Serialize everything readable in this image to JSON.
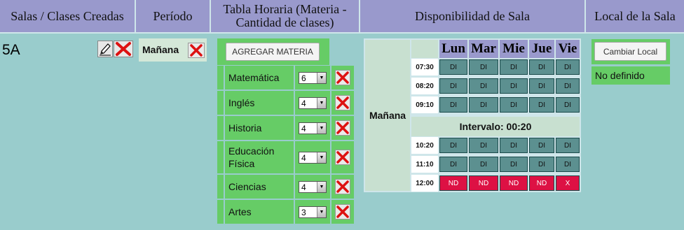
{
  "headers": {
    "salas": "Salas / Clases Creadas",
    "periodo": "Período",
    "tabla": "Tabla Horaria (Materia - Cantidad de clases)",
    "disponibilidad": "Disponibilidad de Sala",
    "local": "Local de la Sala"
  },
  "sala": {
    "name": "5A",
    "edit_icon": "pencil-icon",
    "delete_icon": "red-x-icon"
  },
  "periodo": {
    "label": "Mañana",
    "delete_icon": "red-x-icon"
  },
  "tabla": {
    "add_button": "AGREGAR MATERIA",
    "materias": [
      {
        "name": "Matemática",
        "count": "6"
      },
      {
        "name": "Inglés",
        "count": "4"
      },
      {
        "name": "Historia",
        "count": "4"
      },
      {
        "name": "Educación Física",
        "count": "4"
      },
      {
        "name": "Ciencias",
        "count": "4"
      },
      {
        "name": "Artes",
        "count": "3"
      }
    ]
  },
  "disponibilidad": {
    "periodo": "Mañana",
    "days": [
      "Lun",
      "Mar",
      "Mie",
      "Jue",
      "Vie"
    ],
    "interval_label": "Intervalo: 00:20",
    "rows": [
      {
        "time": "07:30",
        "slots": [
          "DI",
          "DI",
          "DI",
          "DI",
          "DI"
        ]
      },
      {
        "time": "08:20",
        "slots": [
          "DI",
          "DI",
          "DI",
          "DI",
          "DI"
        ]
      },
      {
        "time": "09:10",
        "slots": [
          "DI",
          "DI",
          "DI",
          "DI",
          "DI"
        ]
      },
      {
        "time": "10:20",
        "slots": [
          "DI",
          "DI",
          "DI",
          "DI",
          "DI"
        ]
      },
      {
        "time": "11:10",
        "slots": [
          "DI",
          "DI",
          "DI",
          "DI",
          "DI"
        ]
      },
      {
        "time": "12:00",
        "slots": [
          "ND",
          "ND",
          "ND",
          "ND",
          "X"
        ]
      }
    ],
    "colors": {
      "available": "#5c9090",
      "unavailable": "#dd1144"
    }
  },
  "local": {
    "button": "Cambiar Local",
    "status": "No definido"
  },
  "colors": {
    "header": "#9999cc",
    "background": "#99cccc",
    "green": "#66cc66"
  }
}
